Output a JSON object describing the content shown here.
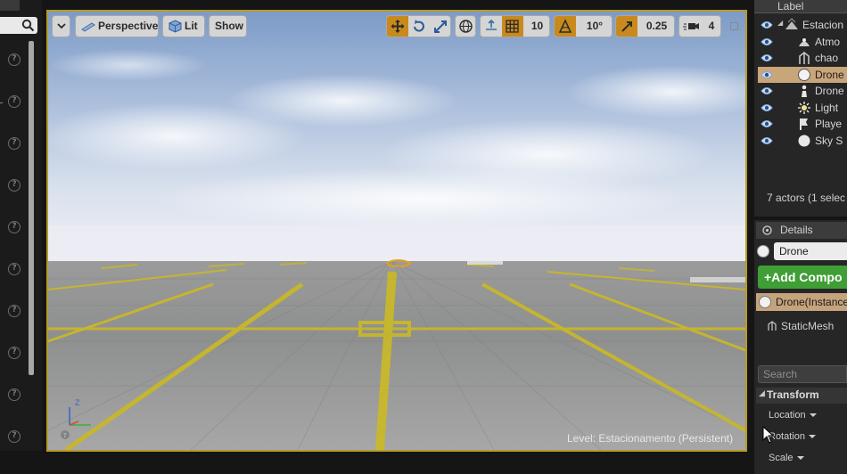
{
  "viewport_toolbar": {
    "view_mode": "Perspective",
    "lighting": "Lit",
    "show": "Show",
    "grid_snap": "10",
    "rotation_snap": "10°",
    "scale_snap": "0.25",
    "camera_speed": "4"
  },
  "viewport": {
    "level_label": "Level:  Estacionamento (Persistent)",
    "axis_z": "Z"
  },
  "outliner": {
    "header": "Label",
    "items": [
      {
        "label": "Estacion",
        "icon": "level-icon",
        "selected": false
      },
      {
        "label": "Atmo",
        "icon": "atmosphere-icon",
        "selected": false
      },
      {
        "label": "chao",
        "icon": "static-mesh-icon",
        "selected": false
      },
      {
        "label": "Drone",
        "icon": "sphere-icon",
        "selected": true
      },
      {
        "label": "Drone",
        "icon": "pawn-icon",
        "selected": false
      },
      {
        "label": "Light",
        "icon": "light-icon",
        "selected": false
      },
      {
        "label": "Playe",
        "icon": "player-start-icon",
        "selected": false
      },
      {
        "label": "Sky S",
        "icon": "sky-sphere-icon",
        "selected": false
      }
    ],
    "count": "7 actors (1 selec"
  },
  "details": {
    "tab_label": "Details",
    "actor_name": "Drone",
    "add_component": "+Add Compo",
    "component_instance": "Drone(Instance",
    "component_mesh": "StaticMesh",
    "search_placeholder": "Search",
    "transform_header": "Transform",
    "location": "Location",
    "rotation": "Rotation",
    "scale": "Scale"
  },
  "colors": {
    "accent_orange": "#c88a1d",
    "selection": "#c9a57a",
    "add_green": "#3f9e35",
    "viewport_border": "#b89a28"
  }
}
